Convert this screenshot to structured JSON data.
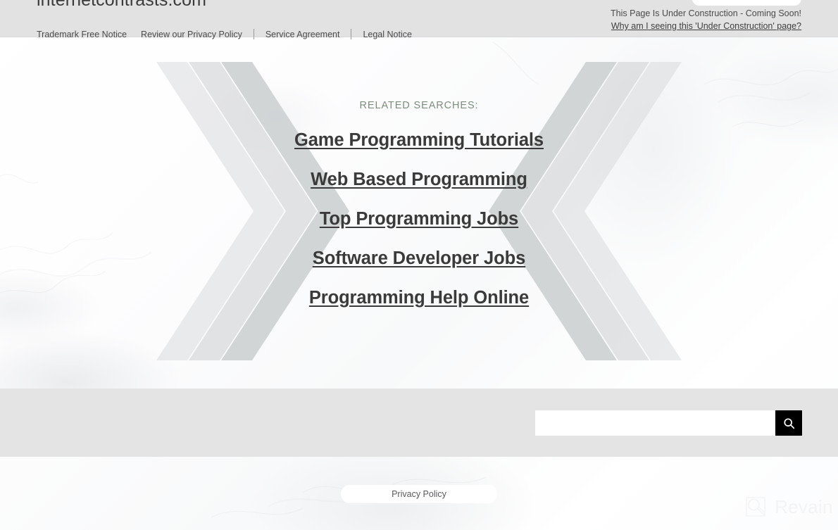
{
  "header": {
    "site_title": "internetcontrasts.com",
    "construction_notice": "This Page Is Under Construction - Coming Soon!",
    "construction_link": "Why am I seeing this 'Under Construction' page?",
    "band_color": "#e2e2e2"
  },
  "main": {
    "related_label": "RELATED SEARCHES:",
    "related_label_color": "#7d8d7d",
    "links": [
      {
        "label": "Game Programming Tutorials"
      },
      {
        "label": "Web Based Programming"
      },
      {
        "label": "Top Programming Jobs"
      },
      {
        "label": "Software Developer Jobs"
      },
      {
        "label": "Programming Help Online"
      }
    ]
  },
  "footer": {
    "links": [
      {
        "label": "Trademark Free Notice"
      },
      {
        "label": "Review our Privacy Policy"
      },
      {
        "label": "Service Agreement"
      },
      {
        "label": "Legal Notice"
      }
    ],
    "band_color": "#e4e4e4",
    "search": {
      "value": "",
      "placeholder": "",
      "button_icon": "search-icon",
      "button_color": "#000000"
    }
  },
  "bottom": {
    "privacy_policy_label": "Privacy Policy",
    "watermark_text": "Revain",
    "watermark_icon": "revain-magnifier-logo"
  }
}
